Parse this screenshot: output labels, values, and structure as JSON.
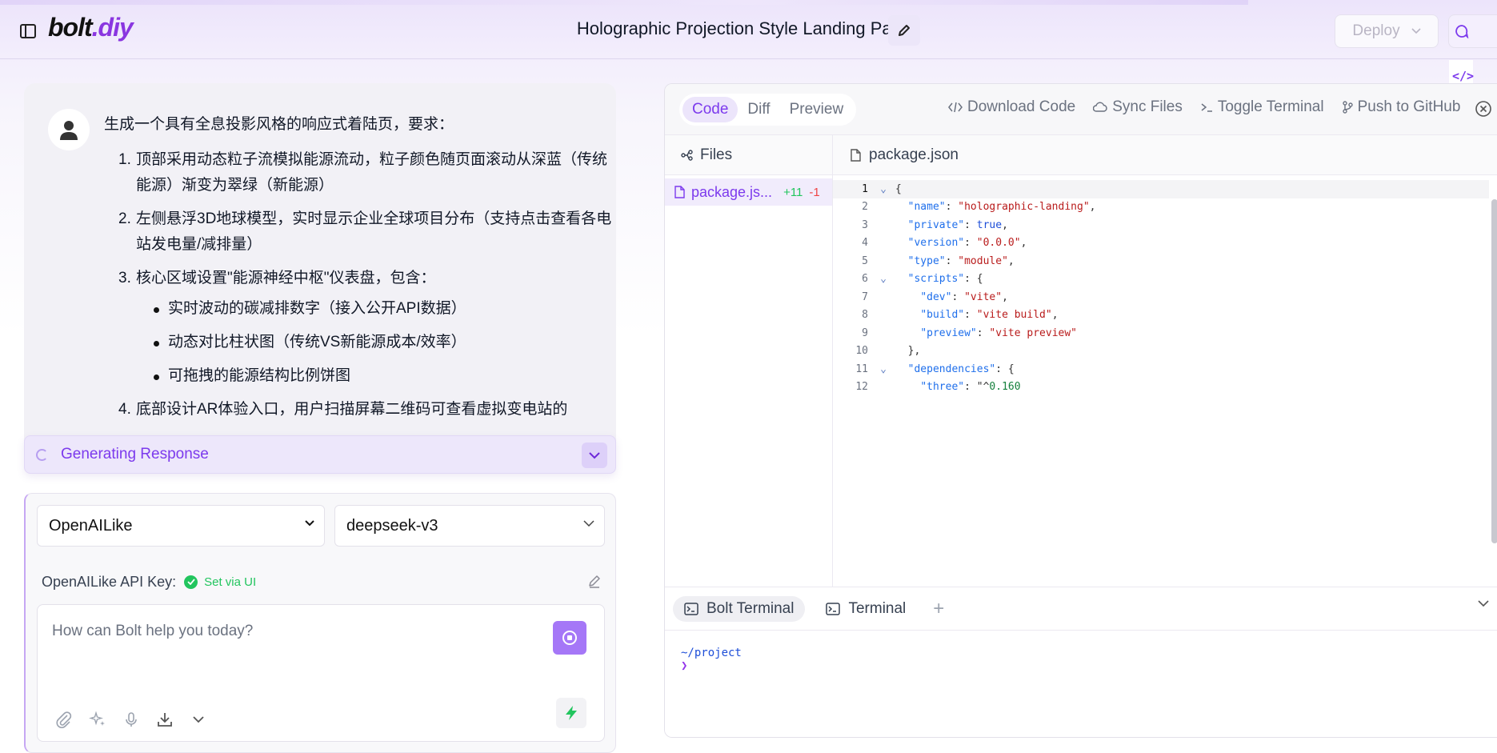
{
  "header": {
    "logo_main": "bolt",
    "logo_suffix": ".diy",
    "title": "Holographic Projection Style Landing Page",
    "deploy_label": "Deploy"
  },
  "chat": {
    "intro": "生成一个具有全息投影风格的响应式着陆页，要求：",
    "items": [
      {
        "num": "1.",
        "text": "顶部采用动态粒子流模拟能源流动，粒子颜色随页面滚动从深蓝（传统能源）渐变为翠绿（新能源）"
      },
      {
        "num": "2.",
        "text": "左侧悬浮3D地球模型，实时显示企业全球项目分布（支持点击查看各电站发电量/减排量）"
      },
      {
        "num": "3.",
        "text": "核心区域设置\"能源神经中枢\"仪表盘，包含："
      },
      {
        "num": "4.",
        "text": "底部设计AR体验入口，用户扫描屏幕二维码可查看虚拟变电站的"
      }
    ],
    "sub_items": [
      "实时波动的碳减排数字（接入公开API数据）",
      "动态对比柱状图（传统VS新能源成本/效率）",
      "可拖拽的能源结构比例饼图"
    ],
    "status": "Generating Response"
  },
  "prompt": {
    "provider": "OpenAILike",
    "model": "deepseek-v3",
    "api_key_label": "OpenAILike API Key:",
    "api_key_status": "Set via UI",
    "placeholder": "How can Bolt help you today?"
  },
  "workbench": {
    "tabs": [
      "Code",
      "Diff",
      "Preview"
    ],
    "active_tab": "Code",
    "actions": [
      "Download Code",
      "Sync Files",
      "Toggle Terminal",
      "Push to GitHub"
    ],
    "files_label": "Files",
    "file": {
      "name": "package.js...",
      "additions": "+11",
      "deletions": "-1"
    },
    "editor_tab": "package.json",
    "line_numbers": [
      "1",
      "2",
      "3",
      "4",
      "5",
      "6",
      "7",
      "8",
      "9",
      "10",
      "11",
      "12"
    ],
    "terminal_tabs": [
      "Bolt Terminal",
      "Terminal"
    ],
    "terminal_path": "~/project",
    "terminal_prompt": "❯"
  },
  "colors": {
    "accent": "#7c3aed",
    "success": "#22c55e",
    "danger": "#ef4444"
  }
}
